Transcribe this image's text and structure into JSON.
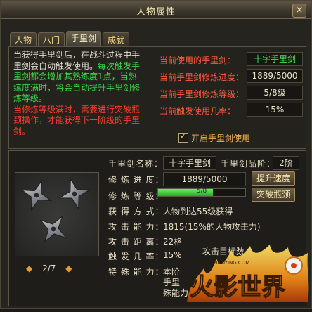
{
  "window": {
    "title": "人物属性",
    "close_label": "×"
  },
  "tabs": [
    "人物",
    "八门",
    "手里剑",
    "成就"
  ],
  "description": {
    "line_white_1": "当获得手里剑后，在战斗过程中手",
    "line_white_2": "里剑会自动触发使用。",
    "line_green_1": "每次触发手",
    "line_green_2": "里剑都会增加其熟练度1点，当熟",
    "line_green_3": "练度满时，将会自动提升手里剑修",
    "line_green_4": "炼等级。",
    "line_red_1": "当修炼等级满时，需要进行突破瓶",
    "line_red_2": "颈操作，才能获得下一阶级的手里",
    "line_red_3": "剑。"
  },
  "stats": {
    "current_label": "当前使用的手里剑：",
    "current_value": "十字手里剑",
    "progress_label": "当前手里剑修炼进度：",
    "progress_value": "1889/5000",
    "level_label": "当前手里剑修炼等级：",
    "level_value": "5/8级",
    "rate_label": "当前触发使用几率：",
    "rate_value": "15%"
  },
  "enable_checkbox_label": "开启手里剑使用",
  "detail": {
    "name_label": "手里剑名称：",
    "name_value": "十字手里剑",
    "rank_label": "手里剑品阶：",
    "rank_value": "2阶",
    "progress_label": "修 炼 进 度：",
    "progress_value": "1889/5000",
    "speed_button": "提升速度",
    "level_label": "修 炼 等 级：",
    "level_bar_text": "5/8",
    "level_fraction": 0.625,
    "break_button": "突破瓶颈",
    "obtain_label": "获 得 方 式：",
    "obtain_value": "人物到达55级获得",
    "attack_label": "攻 击 能 力：",
    "attack_value": "1815(15%的人物攻击力)",
    "distance_label": "攻 击 距 离：",
    "distance_value": "22格",
    "trigger_label": "触 发 几 率：",
    "trigger_value": "15%",
    "target_label": "攻击目标数",
    "special_label": "特 殊 能 力：",
    "special_line_1": "本阶",
    "special_line_2": "手里",
    "special_line_3": "殊能力"
  },
  "pager": {
    "prev_icon": "◆",
    "text": "2/7",
    "next_icon": "◆"
  },
  "logo": {
    "text": "火影世界",
    "url_text": "WWW.NUOYING.COM"
  }
}
